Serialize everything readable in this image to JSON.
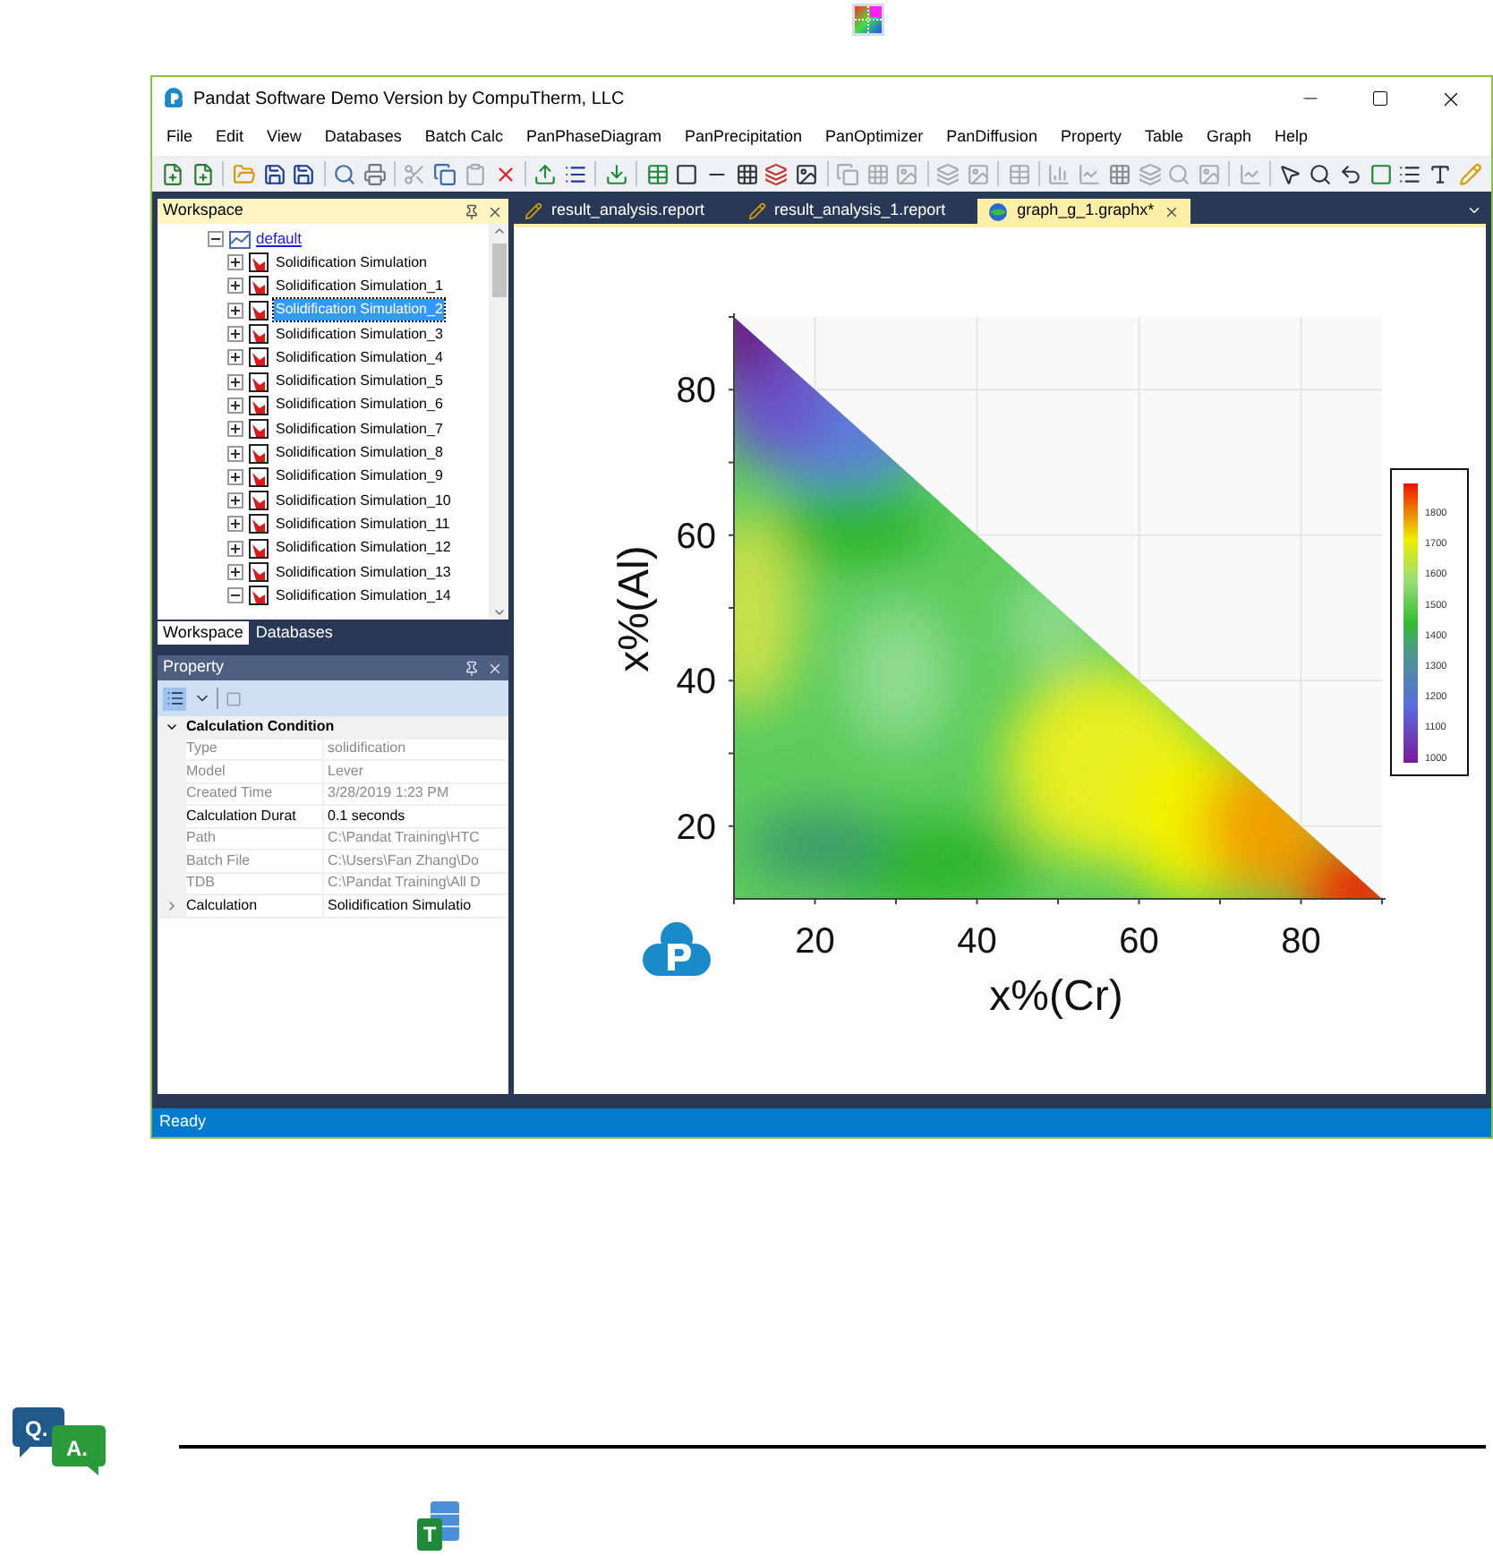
{
  "window": {
    "title": "Pandat Software Demo Version by CompuTherm, LLC"
  },
  "menu": [
    "File",
    "Edit",
    "View",
    "Databases",
    "Batch Calc",
    "PanPhaseDiagram",
    "PanPrecipitation",
    "PanOptimizer",
    "PanDiffusion",
    "Property",
    "Table",
    "Graph",
    "Help"
  ],
  "workspace": {
    "title": "Workspace",
    "root": {
      "label": "default",
      "expanded": true,
      "children": [
        {
          "label": "Solidification Simulation",
          "selected": false,
          "expanded": false
        },
        {
          "label": "Solidification Simulation_1",
          "selected": false,
          "expanded": false
        },
        {
          "label": "Solidification Simulation_2",
          "selected": true,
          "expanded": false
        },
        {
          "label": "Solidification Simulation_3",
          "selected": false,
          "expanded": false
        },
        {
          "label": "Solidification Simulation_4",
          "selected": false,
          "expanded": false
        },
        {
          "label": "Solidification Simulation_5",
          "selected": false,
          "expanded": false
        },
        {
          "label": "Solidification Simulation_6",
          "selected": false,
          "expanded": false
        },
        {
          "label": "Solidification Simulation_7",
          "selected": false,
          "expanded": false
        },
        {
          "label": "Solidification Simulation_8",
          "selected": false,
          "expanded": false
        },
        {
          "label": "Solidification Simulation_9",
          "selected": false,
          "expanded": false
        },
        {
          "label": "Solidification Simulation_10",
          "selected": false,
          "expanded": false
        },
        {
          "label": "Solidification Simulation_11",
          "selected": false,
          "expanded": false
        },
        {
          "label": "Solidification Simulation_12",
          "selected": false,
          "expanded": false
        },
        {
          "label": "Solidification Simulation_13",
          "selected": false,
          "expanded": false
        },
        {
          "label": "Solidification Simulation_14",
          "selected": false,
          "expanded": true
        }
      ]
    }
  },
  "panel_tabs": [
    {
      "label": "Workspace",
      "selected": true
    },
    {
      "label": "Databases",
      "selected": false
    }
  ],
  "property": {
    "title": "Property",
    "rows": [
      {
        "kind": "category",
        "label": "Calculation Condition",
        "expanded": true
      },
      {
        "kind": "field",
        "name": "Type",
        "value": "solidification",
        "readonly": true
      },
      {
        "kind": "field",
        "name": "Model",
        "value": "Lever",
        "readonly": true
      },
      {
        "kind": "field",
        "name": "Created Time",
        "value": "3/28/2019 1:23 PM",
        "readonly": true
      },
      {
        "kind": "field",
        "name": "Calculation Durat",
        "value": "0.1 seconds",
        "readonly": false
      },
      {
        "kind": "field",
        "name": "Path",
        "value": "C:\\Pandat Training\\HTC",
        "readonly": true
      },
      {
        "kind": "field",
        "name": "Batch File",
        "value": "C:\\Users\\Fan Zhang\\Do",
        "readonly": true
      },
      {
        "kind": "field",
        "name": "TDB",
        "value": "C:\\Pandat Training\\All D",
        "readonly": true
      },
      {
        "kind": "field",
        "name": "Calculation",
        "value": "Solidification Simulatio",
        "readonly": false,
        "expanded": false
      }
    ]
  },
  "doc_tabs": [
    {
      "label": "result_analysis.report",
      "kind": "report",
      "selected": false
    },
    {
      "label": "result_analysis_1.report",
      "kind": "report",
      "selected": false
    },
    {
      "label": "graph_g_1.graphx*",
      "kind": "graph",
      "selected": true
    }
  ],
  "graph": {
    "xlabel": "x%(Cr)",
    "ylabel": "x%(Al)",
    "xticks": [
      "20",
      "40",
      "60",
      "80"
    ],
    "yticks": [
      "80",
      "60",
      "40",
      "20"
    ],
    "legend": [
      "1800",
      "1700",
      "1600",
      "1500",
      "1400",
      "1300",
      "1200",
      "1100",
      "1000"
    ]
  },
  "status_bar": "Ready",
  "qa_badge": {
    "question": "Q.",
    "answer": "A."
  },
  "table_badge": "T"
}
